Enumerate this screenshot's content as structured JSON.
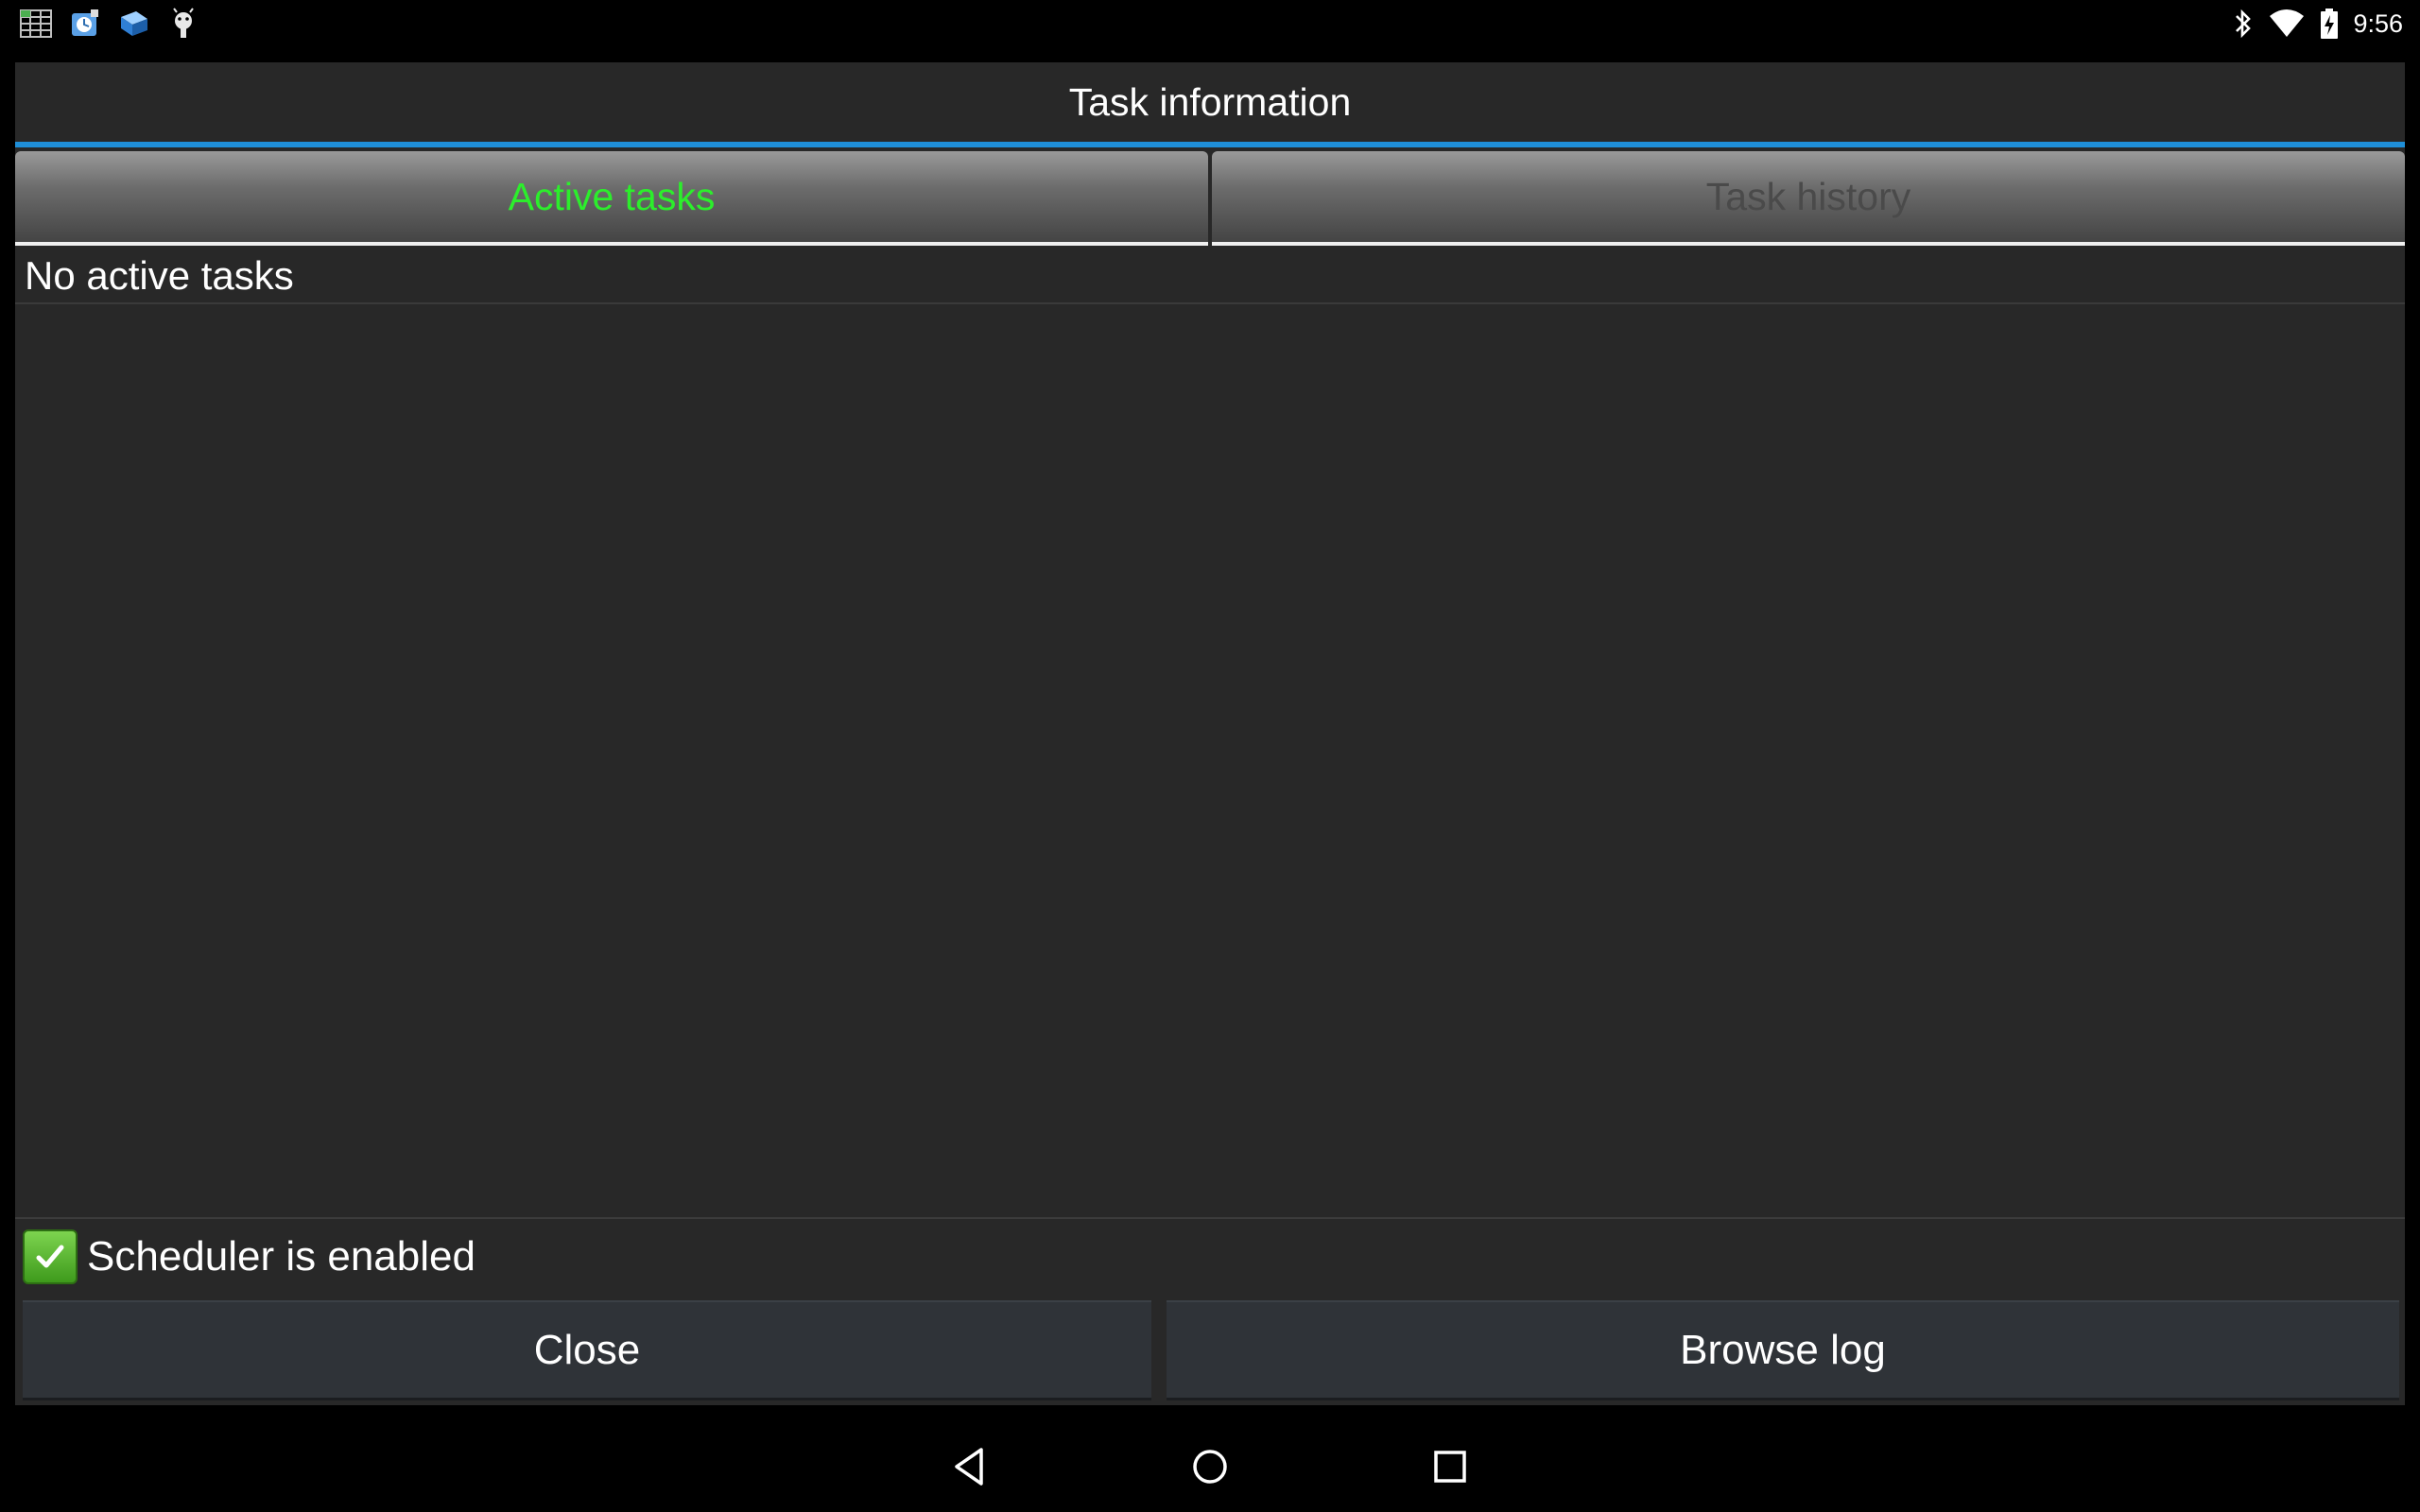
{
  "status_bar": {
    "time": "9:56",
    "left_icons": [
      "spreadsheet-icon",
      "app-icon",
      "app-icon-2",
      "android-debug-icon"
    ],
    "right_icons": [
      "bluetooth-icon",
      "wifi-icon",
      "battery-charging-icon"
    ]
  },
  "dialog": {
    "title": "Task information",
    "tabs": [
      {
        "label": "Active tasks",
        "selected": true
      },
      {
        "label": "Task history",
        "selected": false
      }
    ],
    "empty_message": "No active tasks",
    "scheduler": {
      "label": "Scheduler is enabled",
      "checked": true
    },
    "buttons": {
      "close": "Close",
      "browse_log": "Browse log"
    }
  },
  "colors": {
    "accent_blue": "#1f8fd8",
    "active_tab_text": "#2cee2c",
    "inactive_tab_text": "#4a4a4a",
    "dialog_bg": "#282828"
  },
  "nav_bar": {
    "icons": [
      "back-icon",
      "home-icon",
      "recents-icon"
    ]
  }
}
